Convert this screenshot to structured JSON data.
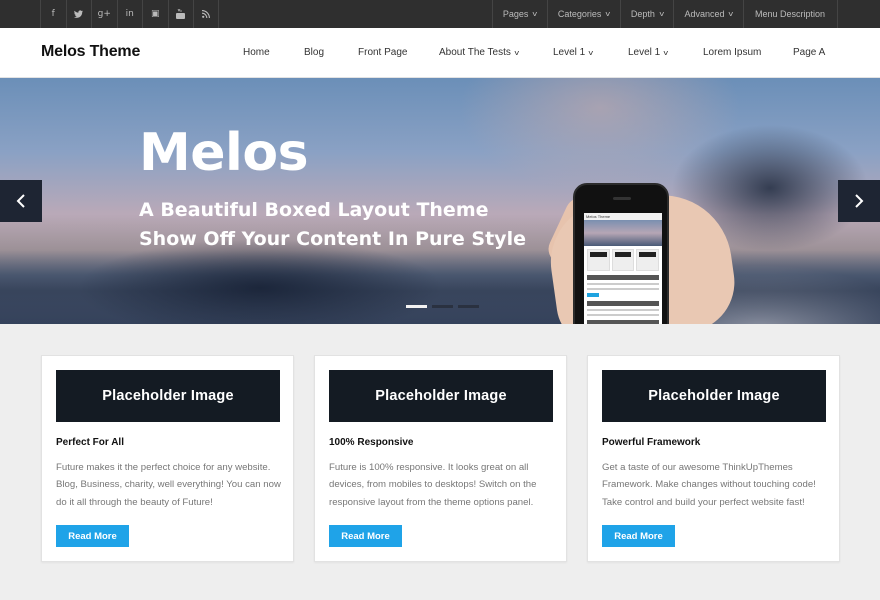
{
  "topbar": {
    "social": [
      {
        "icon": "facebook-icon",
        "glyph": "f"
      },
      {
        "icon": "twitter-icon",
        "glyph": "ᵛ"
      },
      {
        "icon": "google-plus-icon",
        "glyph": "g+"
      },
      {
        "icon": "linkedin-icon",
        "glyph": "in"
      },
      {
        "icon": "flickr-icon",
        "glyph": "▣"
      },
      {
        "icon": "youtube-icon",
        "glyph": "▶"
      },
      {
        "icon": "rss-icon",
        "glyph": "◝"
      }
    ],
    "menu": [
      {
        "label": "Pages",
        "dropdown": true
      },
      {
        "label": "Categories",
        "dropdown": true
      },
      {
        "label": "Depth",
        "dropdown": true
      },
      {
        "label": "Advanced",
        "dropdown": true
      },
      {
        "label": "Menu Description",
        "dropdown": false
      }
    ]
  },
  "header": {
    "logo": "Melos Theme",
    "nav": [
      {
        "label": "Home",
        "dropdown": false
      },
      {
        "label": "Blog",
        "dropdown": false
      },
      {
        "label": "Front Page",
        "dropdown": false
      },
      {
        "label": "About The Tests",
        "dropdown": true
      },
      {
        "label": "Level 1",
        "dropdown": true
      },
      {
        "label": "Level 1",
        "dropdown": true
      },
      {
        "label": "Lorem Ipsum",
        "dropdown": false
      },
      {
        "label": "Page A",
        "dropdown": false
      }
    ]
  },
  "slider": {
    "title": "Melos",
    "line1": "A Beautiful Boxed Layout Theme",
    "line2": "Show Off Your Content In Pure Style",
    "slide_count": 3,
    "active_slide": 1,
    "phone_screen_title": "Melos Theme"
  },
  "cards": [
    {
      "image_label": "Placeholder Image",
      "title": "Perfect For All",
      "text": "Future makes it the perfect choice for any website. Blog, Business, charity, well everything! You can now do it all through the beauty of Future!",
      "button": "Read More"
    },
    {
      "image_label": "Placeholder Image",
      "title": "100% Responsive",
      "text": "Future is 100% responsive. It looks great on all devices, from mobiles to desktops! Switch on the responsive layout from the theme options panel.",
      "button": "Read More"
    },
    {
      "image_label": "Placeholder Image",
      "title": "Powerful Framework",
      "text": "Get a taste of our awesome ThinkUpThemes Framework. Make changes without touching code! Take control and build your perfect website fast!",
      "button": "Read More"
    }
  ],
  "colors": {
    "topbar_bg": "#2f2f2f",
    "accent_button": "#1fa3e8",
    "placeholder_bg": "#141b23",
    "page_bg": "#eeeeee"
  }
}
